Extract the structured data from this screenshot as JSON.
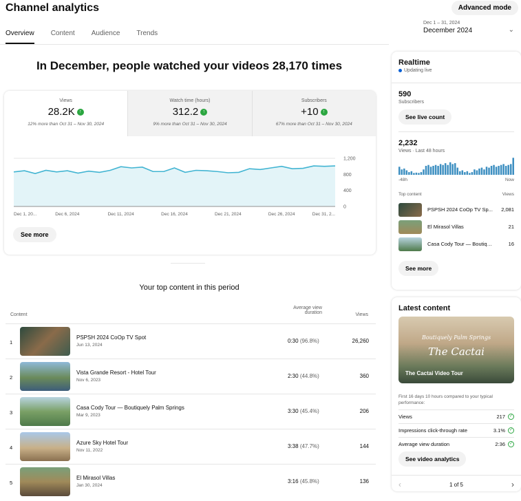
{
  "header": {
    "title": "Channel analytics",
    "advanced_label": "Advanced mode"
  },
  "tabs": [
    "Overview",
    "Content",
    "Audience",
    "Trends"
  ],
  "date": {
    "range": "Dec 1 – 31, 2024",
    "label": "December 2024"
  },
  "headline": "In December, people watched your videos 28,170 times",
  "metrics": [
    {
      "label": "Views",
      "value": "28.2K",
      "note": "12% more than Oct 31 – Nov 30, 2024"
    },
    {
      "label": "Watch time (hours)",
      "value": "312.2",
      "note": "9% more than Oct 31 – Nov 30, 2024"
    },
    {
      "label": "Subscribers",
      "value": "+10",
      "note": "67% more than Oct 31 – Nov 30, 2024"
    }
  ],
  "chart_data": {
    "type": "area",
    "x": [
      "Dec 1",
      "Dec 2",
      "Dec 3",
      "Dec 4",
      "Dec 5",
      "Dec 6",
      "Dec 7",
      "Dec 8",
      "Dec 9",
      "Dec 10",
      "Dec 11",
      "Dec 12",
      "Dec 13",
      "Dec 14",
      "Dec 15",
      "Dec 16",
      "Dec 17",
      "Dec 18",
      "Dec 19",
      "Dec 20",
      "Dec 21",
      "Dec 22",
      "Dec 23",
      "Dec 24",
      "Dec 25",
      "Dec 26",
      "Dec 27",
      "Dec 28",
      "Dec 29",
      "Dec 30",
      "Dec 31"
    ],
    "values": [
      860,
      890,
      820,
      900,
      860,
      890,
      830,
      880,
      850,
      900,
      990,
      960,
      980,
      870,
      870,
      960,
      850,
      900,
      890,
      870,
      840,
      850,
      940,
      920,
      960,
      1000,
      940,
      950,
      1010,
      1000,
      1010
    ],
    "x_tick_labels": [
      "Dec 1, 20...",
      "Dec 6, 2024",
      "Dec 11, 2024",
      "Dec 16, 2024",
      "Dec 21, 2024",
      "Dec 26, 2024",
      "Dec 31, 2..."
    ],
    "y_tick_labels": [
      "1,200",
      "800",
      "400",
      "0"
    ],
    "ylim": [
      0,
      1200
    ],
    "line_color": "#41b4d2",
    "fill_color": "#e3f4f8"
  },
  "see_more_label": "See more",
  "top_content": {
    "title": "Your top content in this period",
    "col_content": "Content",
    "col_duration": "Average view duration",
    "col_views": "Views",
    "rows": [
      {
        "rank": "1",
        "title": "PSPSH 2024 CoOp TV Spot",
        "date": "Jun 13, 2024",
        "duration": "0:30",
        "pct": "(96.8%)",
        "views": "26,260"
      },
      {
        "rank": "2",
        "title": "Vista Grande Resort - Hotel Tour",
        "date": "Nov 6, 2023",
        "duration": "2:30",
        "pct": "(44.8%)",
        "views": "360"
      },
      {
        "rank": "3",
        "title": "Casa Cody Tour — Boutiquely Palm Springs",
        "date": "Mar 9, 2023",
        "duration": "3:30",
        "pct": "(45.4%)",
        "views": "206"
      },
      {
        "rank": "4",
        "title": "Azure Sky Hotel Tour",
        "date": "Nov 11, 2022",
        "duration": "3:38",
        "pct": "(47.7%)",
        "views": "144"
      },
      {
        "rank": "5",
        "title": "El Mirasol Villas",
        "date": "Jan 30, 2024",
        "duration": "3:16",
        "pct": "(45.8%)",
        "views": "136"
      }
    ]
  },
  "realtime": {
    "title": "Realtime",
    "status": "Updating live",
    "subs_value": "590",
    "subs_label": "Subscribers",
    "live_btn": "See live count",
    "views_value": "2,232",
    "views_label": "Views · Last 48 hours",
    "bars": [
      0.45,
      0.3,
      0.35,
      0.25,
      0.15,
      0.2,
      0.1,
      0.12,
      0.1,
      0.15,
      0.3,
      0.5,
      0.55,
      0.45,
      0.5,
      0.55,
      0.5,
      0.6,
      0.55,
      0.65,
      0.55,
      0.7,
      0.6,
      0.65,
      0.4,
      0.2,
      0.25,
      0.15,
      0.2,
      0.1,
      0.15,
      0.3,
      0.25,
      0.35,
      0.4,
      0.3,
      0.45,
      0.4,
      0.5,
      0.55,
      0.45,
      0.5,
      0.55,
      0.6,
      0.5,
      0.55,
      0.6,
      0.95
    ],
    "axis_left": "-48h",
    "axis_right": "Now",
    "top_content_label": "Top content",
    "views_col": "Views",
    "items": [
      {
        "title": "PSPSH 2024 CoOp TV Sp...",
        "views": "2,081"
      },
      {
        "title": "El Mirasol Villas",
        "views": "21"
      },
      {
        "title": "Casa Cody Tour — Boutiquel...",
        "views": "16"
      }
    ],
    "see_more": "See more"
  },
  "latest": {
    "title": "Latest content",
    "thumb_line1": "Boutiquely Palm Springs",
    "thumb_line2": "The Cactai",
    "video_title": "The Cactai Video Tour",
    "compare_text": "First 16 days 10 hours compared to your typical performance:",
    "stats": [
      {
        "label": "Views",
        "value": "217"
      },
      {
        "label": "Impressions click-through rate",
        "value": "3.1%"
      },
      {
        "label": "Average view duration",
        "value": "2:36"
      }
    ],
    "btn": "See video analytics",
    "pager": "1 of 5"
  }
}
